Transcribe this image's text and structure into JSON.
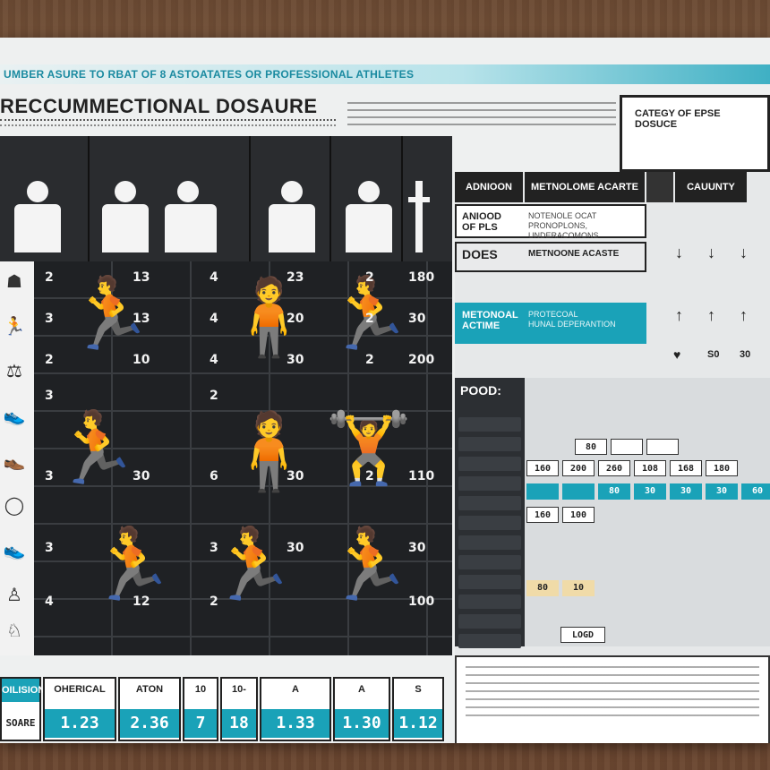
{
  "poster": {
    "subtitle": "UMBER ASURE TO RBAT OF 8 ASTOATATES OR PROFESSIONAL ATHLETES",
    "title": "RECCUMMECTIONAL DOSAURE",
    "category_box": "CATEGY OF EPSE\nDOSUCE"
  },
  "left_grid": {
    "rows": [
      [
        "2",
        "13",
        "4",
        "23",
        "2",
        "180"
      ],
      [
        "3",
        "13",
        "4",
        "20",
        "2",
        "30"
      ],
      [
        "2",
        "10",
        "4",
        "30",
        "2",
        "200"
      ],
      [
        "3",
        "",
        "2",
        "",
        "",
        ""
      ],
      [
        "3",
        "30",
        "6",
        "30",
        "2",
        "110"
      ],
      [
        "3",
        "",
        "3",
        "30",
        "",
        "30"
      ],
      [
        "4",
        "12",
        "2",
        "",
        "",
        "100"
      ]
    ]
  },
  "stats": [
    {
      "label": "OILISION",
      "value": "",
      "teal_label": true
    },
    {
      "label": "OHERICAL",
      "value": "1.23",
      "teal_label": false
    },
    {
      "label": "ATON",
      "value": "2.36",
      "teal_label": false
    },
    {
      "label": "10",
      "value": "7",
      "teal_label": false
    },
    {
      "label": "10-",
      "value": "18",
      "teal_label": false
    },
    {
      "label": "A",
      "value": "1.33",
      "teal_label": false
    },
    {
      "label": "A",
      "value": "1.30",
      "teal_label": false
    },
    {
      "label": "S",
      "value": "1.12",
      "teal_label": false
    }
  ],
  "stats_side_label": "SOARE",
  "right_panel": {
    "headers": [
      "ADNIOON",
      "METNOLOME ACARTE",
      "",
      "CAUUNTY"
    ],
    "rows": [
      {
        "k": "ANIOOD\nOF PLS",
        "v": "NOTENOLE OCAT\nPRONOPLONS, UNDERACOMONS"
      },
      {
        "k": "DOES",
        "v": "METNOONE ACASTE"
      },
      {
        "k": "METONOAL\nACTIME",
        "v": "PROTECOAL\nHUNAL DEPERANTION"
      }
    ],
    "food_title": "POOD:",
    "food_values": {
      "r1": [
        "80",
        "",
        ""
      ],
      "r2": [
        "160",
        "200",
        "260",
        "108",
        "168",
        "180"
      ],
      "r3": [
        "",
        "",
        "80",
        "30",
        "30",
        "30",
        "60"
      ],
      "r4": [
        "160",
        "100"
      ],
      "r5": [
        "80",
        "10"
      ],
      "r6": [
        "LOGD"
      ]
    },
    "arrow_labels": [
      "S0",
      "30"
    ]
  }
}
